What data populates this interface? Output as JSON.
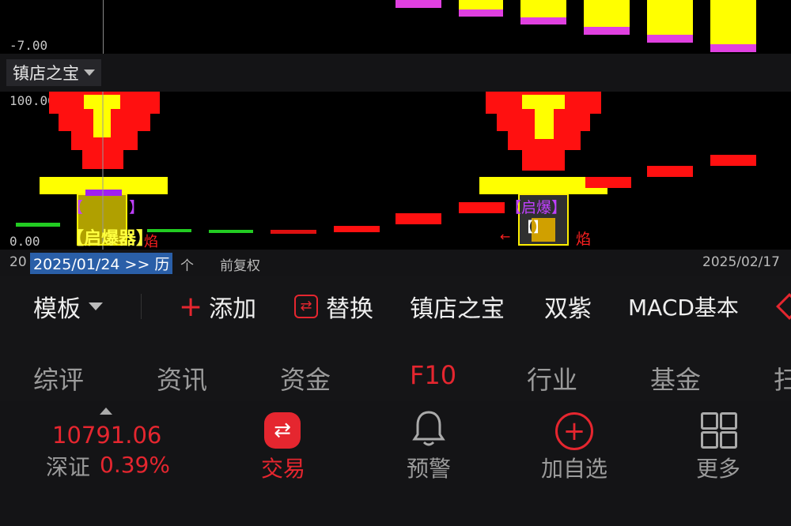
{
  "top_chart": {
    "min_label": "-7.00"
  },
  "indicator": {
    "selector_label": "镇店之宝",
    "max_label": "100.00",
    "min_label": "0.00",
    "signal1": "【启爆器】",
    "signal1_top": "【】",
    "signal1_side": "焰",
    "signal2_top": "【启爆】",
    "signal2_bracket": "【】",
    "signal2_side": "焰"
  },
  "date_bar": {
    "left_prefix": "20",
    "selected_date": "2025/01/24 >> 历",
    "trailing": "个",
    "adjust_mode": "前复权",
    "end_date": "2025/02/17"
  },
  "toolbar": {
    "template_label": "模板",
    "add_label": "添加",
    "replace_label": "替换",
    "items": [
      "镇店之宝",
      "双紫",
      "MACD基本"
    ],
    "colors": {
      "accent": "#e5262f"
    }
  },
  "tabs": {
    "items": [
      "综评",
      "资讯",
      "资金",
      "F10",
      "行业",
      "基金",
      "扫"
    ],
    "active": "F10"
  },
  "bottom": {
    "index_value": "10791.06",
    "index_name": "深证",
    "index_change": "0.39%",
    "nav": [
      {
        "label": "交易",
        "icon": "trade-icon",
        "active": true
      },
      {
        "label": "预警",
        "icon": "bell-icon"
      },
      {
        "label": "加自选",
        "icon": "plus-circle-icon"
      },
      {
        "label": "更多",
        "icon": "grid-icon"
      }
    ]
  }
}
